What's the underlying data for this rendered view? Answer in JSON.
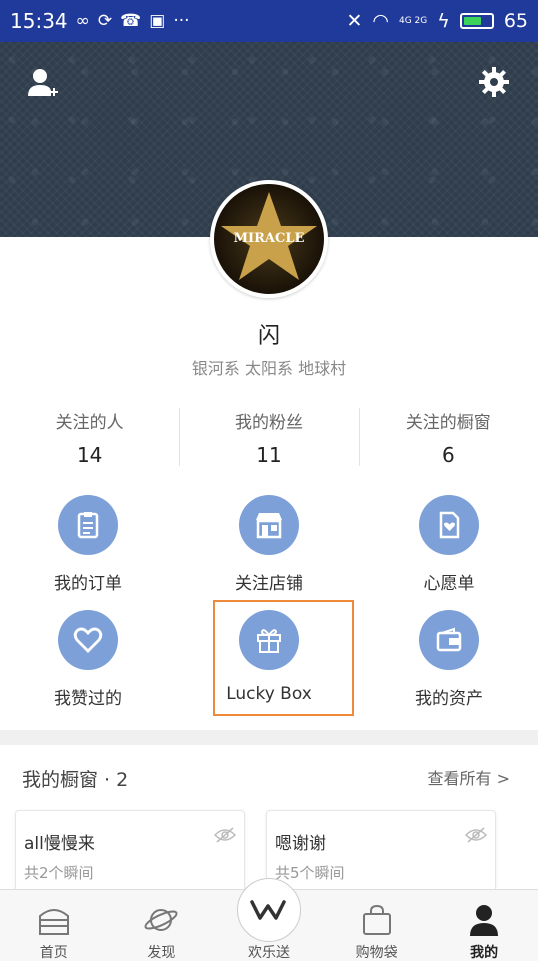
{
  "status_bar": {
    "time": "15:34",
    "battery": "65",
    "signal_text": "4G 2G"
  },
  "profile": {
    "nickname": "闪",
    "location": "银河系 太阳系 地球村",
    "avatar_text": "MIRACLE"
  },
  "stats": [
    {
      "label": "关注的人",
      "value": "14"
    },
    {
      "label": "我的粉丝",
      "value": "11"
    },
    {
      "label": "关注的橱窗",
      "value": "6"
    }
  ],
  "grid": [
    {
      "label": "我的订单",
      "icon": "clipboard-icon"
    },
    {
      "label": "关注店铺",
      "icon": "store-icon"
    },
    {
      "label": "心愿单",
      "icon": "wishlist-icon"
    },
    {
      "label": "我赞过的",
      "icon": "heart-icon"
    },
    {
      "label": "Lucky Box",
      "icon": "gift-icon"
    },
    {
      "label": "我的资产",
      "icon": "wallet-icon"
    }
  ],
  "showcase": {
    "title": "我的橱窗 · 2",
    "view_all": "查看所有 >",
    "cards": [
      {
        "name": "all慢慢来",
        "count": "共2个瞬间"
      },
      {
        "name": "嗯谢谢",
        "count": "共5个瞬间"
      }
    ]
  },
  "nav": [
    {
      "label": "首页"
    },
    {
      "label": "发现"
    },
    {
      "label": "欢乐送"
    },
    {
      "label": "购物袋"
    },
    {
      "label": "我的"
    }
  ],
  "colors": {
    "status_bar": "#1f3a9a",
    "icon_circle": "#7da0d8",
    "highlight": "#ef8a3a"
  }
}
